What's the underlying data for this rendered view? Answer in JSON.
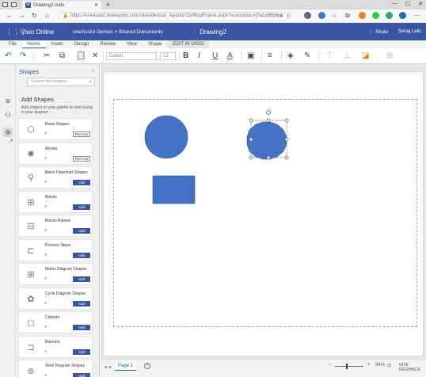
{
  "browser": {
    "tab_title": "Drawing2.vsdx",
    "tab_icon": "W",
    "url": "https://oneassist.sharepoint.com/sites/demos/_layouts/15/WopiFrame.aspx?sourcedoc={0a1a96b6-a"
  },
  "app": {
    "name": "Visio Online",
    "breadcrumb": "oneAssist Demos > Shared Documents",
    "doc_title": "Drawing2",
    "share_label": "Share",
    "user_name": "Senaj Lelic",
    "brand_color": "#3955a3"
  },
  "ribbon": {
    "tabs": [
      "File",
      "Home",
      "Insert",
      "Design",
      "Review",
      "View",
      "Shape",
      "EDIT IN VISIO"
    ],
    "active_tab": "Home",
    "font_name": "Calibri",
    "font_size": "12"
  },
  "panel": {
    "title": "Shapes",
    "search_placeholder": "Search for shapes",
    "add_title": "Add Shapes",
    "add_description": "Add shapes to your palette to start using in your diagram",
    "stencils": [
      {
        "name": "Basic Shapes",
        "button": "Remove",
        "icon": "basic-shapes-icon",
        "glyph": "⬡"
      },
      {
        "name": "Arrows",
        "button": "Remove",
        "icon": "arrows-icon",
        "glyph": "✺"
      },
      {
        "name": "Basic Flowchart Shapes",
        "button": "Add",
        "icon": "flowchart-icon",
        "glyph": "⚲"
      },
      {
        "name": "Blocks",
        "button": "Add",
        "icon": "blocks-icon",
        "glyph": "⊞"
      },
      {
        "name": "Blocks Raised",
        "button": "Add",
        "icon": "blocks-raised-icon",
        "glyph": "⊟"
      },
      {
        "name": "Process Steps",
        "button": "Add",
        "icon": "process-steps-icon",
        "glyph": "⊏"
      },
      {
        "name": "Matrix Diagram Shapes",
        "button": "Add",
        "icon": "matrix-icon",
        "glyph": "⊞"
      },
      {
        "name": "Cycle Diagram Shapes",
        "button": "Add",
        "icon": "cycle-icon",
        "glyph": "✿"
      },
      {
        "name": "Callouts",
        "button": "Add",
        "icon": "callouts-icon",
        "glyph": "◻"
      },
      {
        "name": "Banners",
        "button": "Add",
        "icon": "banners-icon",
        "glyph": "⊐"
      },
      {
        "name": "Venn Diagram Shapes",
        "button": "Add",
        "icon": "venn-icon",
        "glyph": "⊛"
      }
    ]
  },
  "canvas": {
    "shape_fill": "#4472c4",
    "shape_stroke": "#2f5597"
  },
  "status": {
    "page_tab": "Page 1",
    "zoom": "94%",
    "feedback": "GIVE FEEDBACK"
  }
}
